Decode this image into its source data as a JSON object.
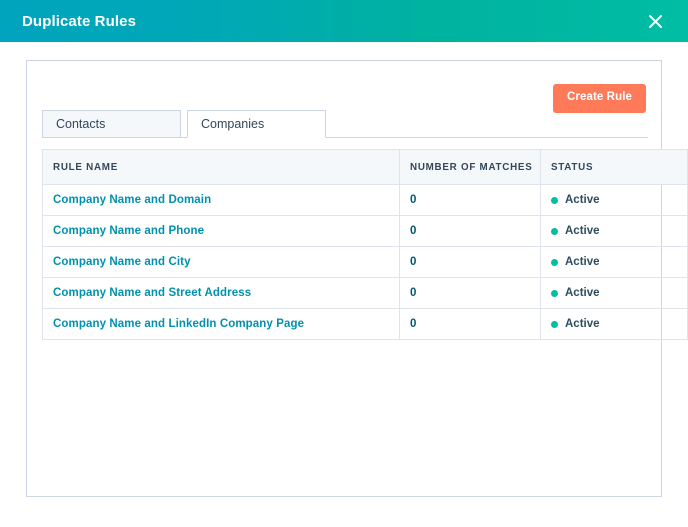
{
  "header": {
    "title": "Duplicate Rules",
    "close_icon": "close-icon",
    "gradient_start": "#00a4bd",
    "gradient_end": "#00bda5"
  },
  "toolbar": {
    "create_rule_label": "Create Rule",
    "create_rule_color": "#ff7a59"
  },
  "tabs": [
    {
      "label": "Contacts",
      "active": false
    },
    {
      "label": "Companies",
      "active": true
    }
  ],
  "table": {
    "columns": [
      {
        "key": "rule_name",
        "label": "RULE NAME"
      },
      {
        "key": "matches",
        "label": "NUMBER OF MATCHES"
      },
      {
        "key": "status",
        "label": "STATUS"
      }
    ],
    "link_color": "#0091ae",
    "status_dot_color": "#00bda5",
    "rows": [
      {
        "rule_name": "Company Name and Domain",
        "matches": "0",
        "status": "Active"
      },
      {
        "rule_name": "Company Name and Phone",
        "matches": "0",
        "status": "Active"
      },
      {
        "rule_name": "Company Name and City",
        "matches": "0",
        "status": "Active"
      },
      {
        "rule_name": "Company Name and Street Address",
        "matches": "0",
        "status": "Active"
      },
      {
        "rule_name": "Company Name and LinkedIn Company Page",
        "matches": "0",
        "status": "Active"
      }
    ]
  }
}
